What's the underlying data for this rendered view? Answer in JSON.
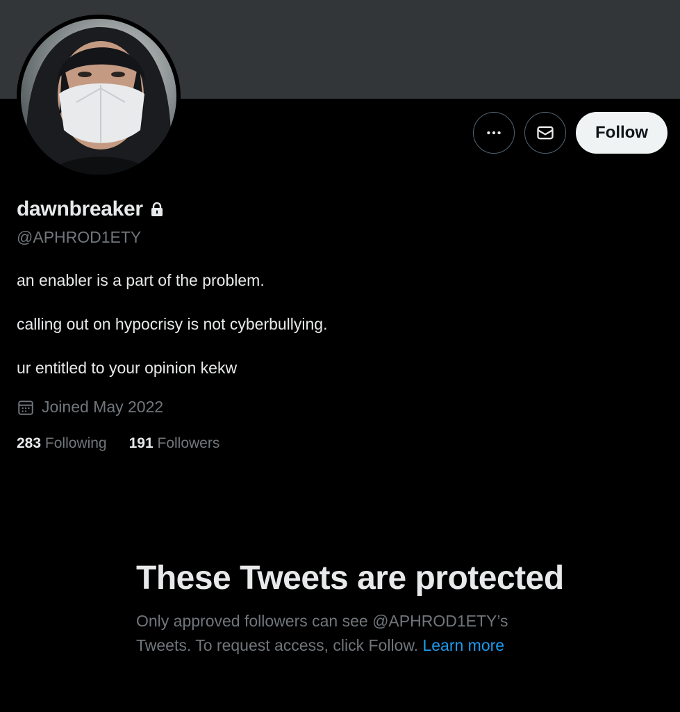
{
  "profile": {
    "display_name": "dawnbreaker",
    "handle": "@APHROD1ETY",
    "bio": [
      "an enabler is a part of the problem.",
      "calling out on hypocrisy is not cyberbullying.",
      "ur entitled to your opinion kekw"
    ],
    "joined": "Joined May 2022",
    "following_count": "283",
    "following_label": "Following",
    "followers_count": "191",
    "followers_label": "Followers"
  },
  "actions": {
    "more_icon": "more-horizontal-icon",
    "message_icon": "envelope-icon",
    "follow_label": "Follow"
  },
  "protected_notice": {
    "title": "These Tweets are protected",
    "description": "Only approved followers can see @APHROD1ETY’s Tweets. To request access, click Follow.",
    "learn_more": "Learn more"
  },
  "colors": {
    "background": "#000000",
    "banner": "#333639",
    "text_primary": "#e7e9ea",
    "text_secondary": "#71767b",
    "link": "#1d9bf0",
    "follow_button_bg": "#eff3f4"
  }
}
